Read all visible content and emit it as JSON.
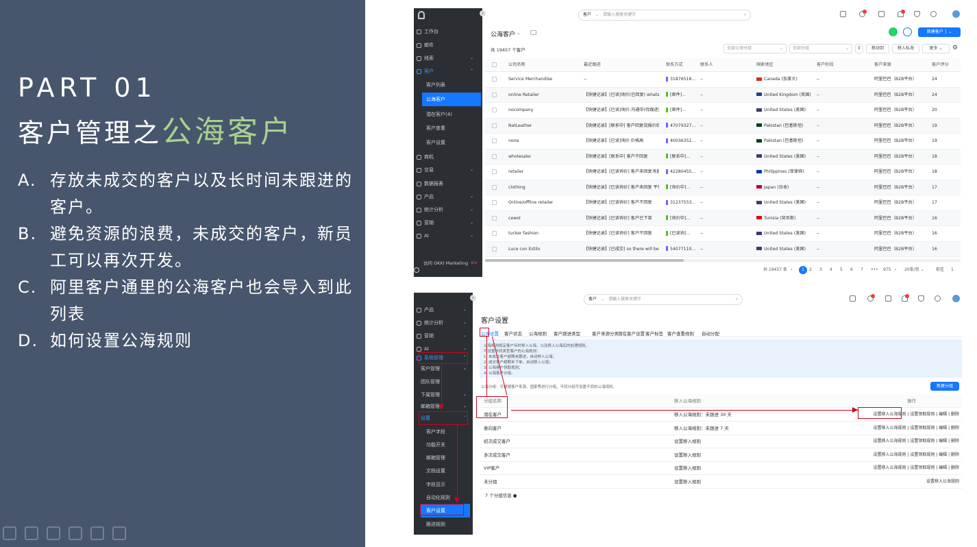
{
  "slide": {
    "part": "PART 01",
    "title_prefix": "客户管理之",
    "title_accent": "公海客户",
    "points": [
      {
        "letter": "A.",
        "text": "存放未成交的客户以及长时间未跟进的客户。"
      },
      {
        "letter": "B.",
        "text": "避免资源的浪费，未成交的客户，新员工可以再次开发。"
      },
      {
        "letter": "C.",
        "text": "阿里客户通里的公海客户也会导入到此列表"
      },
      {
        "letter": "D.",
        "text": "如何设置公海规则"
      }
    ]
  },
  "shot1": {
    "search_scope": "客户",
    "search_placeholder": "请输入搜索关键字",
    "sidebar": [
      {
        "label": "工作台"
      },
      {
        "label": "邮件"
      },
      {
        "label": "线索"
      },
      {
        "label": "客户"
      }
    ],
    "sidebar_sub": [
      "客户列表",
      "公海客户",
      "潜在客户(4)",
      "客户查重",
      "客户设置"
    ],
    "sidebar_rest": [
      {
        "label": "商机"
      },
      {
        "label": "交易"
      },
      {
        "label": "数据报表"
      },
      {
        "label": "产品"
      },
      {
        "label": "统计分析"
      },
      {
        "label": "营销"
      },
      {
        "label": "AI"
      }
    ],
    "footer_label": "访问 OKKI Marketing",
    "footer_badge": "NEW",
    "page_title": "公海客户",
    "count_label": "共 19457 个客户",
    "new_button": "新建客户",
    "filter1": "全部公海分组",
    "filter2": "全部分组",
    "btn_move": "移动到",
    "btn_move_private": "移入私海",
    "btn_more": "更多",
    "headers": [
      "公司名称",
      "最近跟进",
      "联系方式",
      "联系人",
      "国家地区",
      "客户阶段",
      "客户来源",
      "客户评分"
    ],
    "rows": [
      {
        "name": "Service Merchandise",
        "follow": "--",
        "contact": "31876518...",
        "person": "--",
        "country": "Canada (加拿大)",
        "stage": "--",
        "source": "阿里巴巴（B2B平台）",
        "score": "24"
      },
      {
        "name": "online Retailer",
        "follow": "【快捷记录】[已读]询价(已回复) whats...",
        "contact": "[邮件]...",
        "person": "--",
        "country": "United Kingdom (英国)",
        "stage": "--",
        "source": "阿里巴巴（B2B平台）",
        "score": "24"
      },
      {
        "name": "nocompany",
        "follow": "【快捷记录】[已读]询价-沟通中(待跟进)",
        "contact": "[邮件]...",
        "person": "--",
        "country": "United States (美国)",
        "stage": "--",
        "source": "阿里巴巴（B2B平台）",
        "score": "20"
      },
      {
        "name": "NatLeather",
        "follow": "【快捷记录】[联系中] 客户回复说报价给...",
        "contact": "47079327...",
        "person": "--",
        "country": "Pakistan (巴基斯坦)",
        "stage": "--",
        "source": "阿里巴巴（B2B平台）",
        "score": "19"
      },
      {
        "name": "none",
        "follow": "【快捷记录】[已读]询价 价格高",
        "contact": "40036352...",
        "person": "--",
        "country": "Pakistan (巴基斯坦)",
        "stage": "--",
        "source": "阿里巴巴（B2B平台）",
        "score": "19"
      },
      {
        "name": "wholesaler",
        "follow": "【快捷记录】[联系中] 客户不回复",
        "contact": "[联系中]...",
        "person": "--",
        "country": "United States (美国)",
        "stage": "--",
        "source": "阿里巴巴（B2B平台）",
        "score": "18"
      },
      {
        "name": "retailer",
        "follow": "【快捷记录】[已读询价] 客户未回复消息",
        "contact": "42280455...",
        "person": "--",
        "country": "Philippines (菲律宾)",
        "stage": "--",
        "source": "阿里巴巴（B2B平台）",
        "score": "18"
      },
      {
        "name": "clothing",
        "follow": "【快捷记录】[已读询价] 客户未回复 平行...",
        "contact": "[询价中]...",
        "person": "--",
        "country": "Japan (日本)",
        "stage": "--",
        "source": "阿里巴巴（B2B平台）",
        "score": "17"
      },
      {
        "name": "Online/offline retailer",
        "follow": "【快捷记录】[已读询价] 客户不回复",
        "contact": "31237553...",
        "person": "--",
        "country": "United States (美国)",
        "stage": "--",
        "source": "阿里巴巴（B2B平台）",
        "score": "17"
      },
      {
        "name": "cewol",
        "follow": "【快捷记录】[已读询价] 客户已下单",
        "contact": "[询价中]...",
        "person": "--",
        "country": "Tunisia (突尼斯)",
        "stage": "--",
        "source": "阿里巴巴（B2B平台）",
        "score": "16"
      },
      {
        "name": "tucker fashion",
        "follow": "【快捷记录】[已读询价] 客户不回复",
        "contact": "[已读询]...",
        "person": "--",
        "country": "United States (美国)",
        "stage": "--",
        "source": "阿里巴巴（B2B平台）",
        "score": "16"
      },
      {
        "name": "Luce con Estilo",
        "follow": "【快捷记录】[已成交] so there will be b...",
        "contact": "54077110...",
        "person": "--",
        "country": "United States (美国)",
        "stage": "--",
        "source": "阿里巴巴（B2B平台）",
        "score": "16"
      }
    ],
    "pagination": {
      "total": "共 19457 条",
      "pages": [
        "1",
        "2",
        "3",
        "4",
        "5",
        "6",
        "7",
        "•••",
        "975"
      ],
      "active": "1",
      "page_size": "20条/页",
      "goto_label": "前往",
      "goto_value": "1"
    }
  },
  "shot2": {
    "search_scope": "客户",
    "search_placeholder": "请输入搜索关键字",
    "sidebar": [
      {
        "label": "产品"
      },
      {
        "label": "统计分析"
      },
      {
        "label": "营销"
      },
      {
        "label": "AI"
      },
      {
        "label": "系统管理"
      }
    ],
    "sidebar_sub1": [
      "客户管理",
      "团队管理",
      "下属管理",
      "邮箱管理"
    ],
    "sidebar_settings": "设置",
    "sidebar_sub2": [
      "客户字段",
      "功能开关",
      "邮箱管理",
      "文档设置",
      "字段显示",
      "自动化规则",
      "客户设置",
      "跟进规则"
    ],
    "page_title": "客户设置",
    "tabs": [
      "公海设置",
      "客户状态",
      "公海规则",
      "客户跟进类型",
      "客户来源分类",
      "潜在客户设置",
      "客户标签",
      "客户查重规则",
      "自动分配"
    ],
    "info_lines": [
      "公海规则规定客户何时移入公海，以及移入公海后的处理规则。",
      "可设置不同类型客户的公海规则：",
      "1. 未成交客户超期未跟进，自动移入公海；",
      "2. 成交客户超期未下单，自动移入公海；",
      "3. 公海客户领取规则；",
      "4. 公海客户分组。"
    ],
    "subtitle": "公海分组：可根据客户来源、国家等进行分组，不同分组可设置不同的公海规则。",
    "new_group_button": "新建分组",
    "col_name": "分组名称",
    "col_rule": "移入公海规则",
    "col_op": "操作",
    "rows": [
      {
        "name": "潜在客户",
        "rule": "移入公海规则：未跟进 30 天",
        "ops": "设置移入公海规则 | 设置领取规则 | 编辑 | 删除"
      },
      {
        "name": "意向客户",
        "rule": "移入公海规则：未跟进 7 天",
        "ops": "设置移入公海规则 | 设置领取规则 | 编辑 | 删除"
      },
      {
        "name": "初次成交客户",
        "rule": "设置移入规则",
        "ops": "设置移入公海规则 | 设置领取规则 | 编辑 | 删除"
      },
      {
        "name": "多次成交客户",
        "rule": "设置移入规则",
        "ops": "设置移入公海规则 | 设置领取规则 | 编辑 | 删除"
      },
      {
        "name": "VIP客户",
        "rule": "设置移入规则",
        "ops": "设置移入公海规则 | 设置领取规则 | 编辑 | 删除"
      },
      {
        "name": "未分组",
        "rule": "设置移入规则",
        "ops": "设置移入公海规则"
      }
    ],
    "footer": "7 个分组信息"
  }
}
